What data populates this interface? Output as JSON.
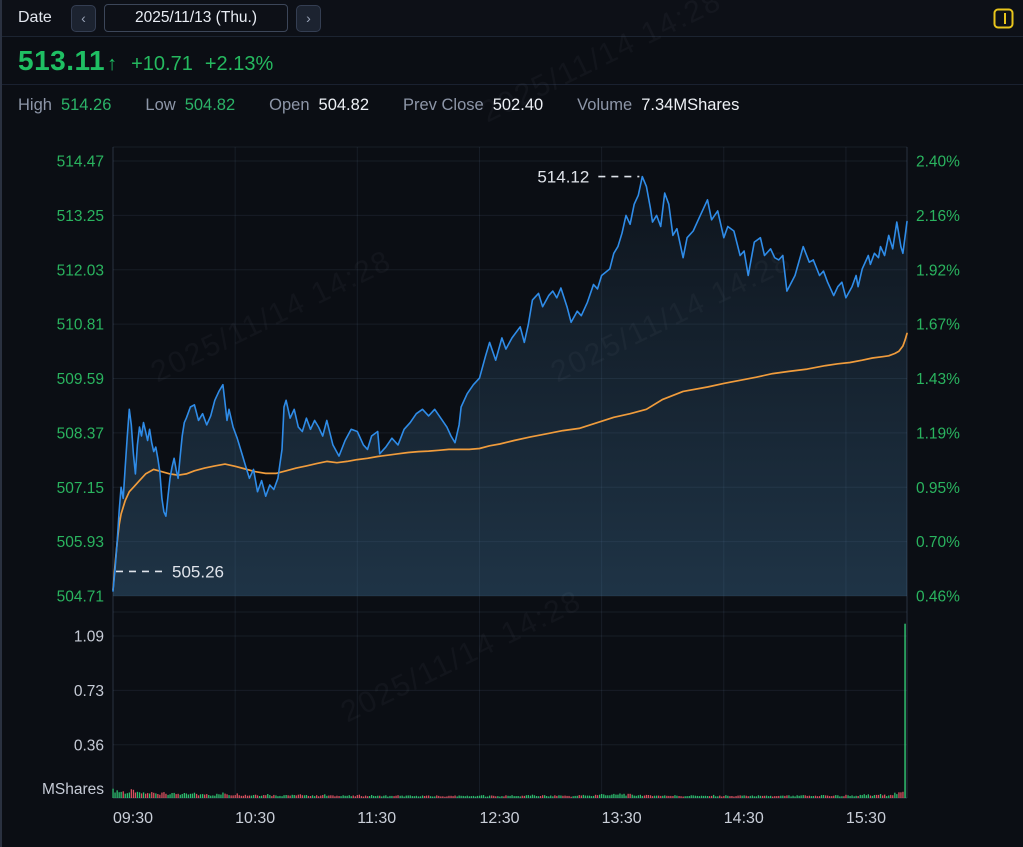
{
  "header": {
    "date_label": "Date",
    "prev_icon": "‹",
    "next_icon": "›",
    "date_value": "2025/11/13 (Thu.)"
  },
  "quote": {
    "price": "513.11",
    "arrow": "↑",
    "change": "+10.71",
    "change_pct": "+2.13%"
  },
  "stats": {
    "high_label": "High",
    "high": "514.26",
    "low_label": "Low",
    "low": "504.82",
    "open_label": "Open",
    "open": "504.82",
    "prev_close_label": "Prev Close",
    "prev_close": "502.40",
    "volume_label": "Volume",
    "volume": "7.34MShares"
  },
  "watermark": {
    "text": "2025/11/14 14:28"
  },
  "chart_data": {
    "type": "line",
    "title": "Intraday price with average price line and volume",
    "price_axis": {
      "left_labels": [
        "514.47",
        "513.25",
        "512.03",
        "510.81",
        "509.59",
        "508.37",
        "507.15",
        "505.93",
        "504.71"
      ],
      "right_labels": [
        "2.40%",
        "2.16%",
        "1.92%",
        "1.67%",
        "1.43%",
        "1.19%",
        "0.95%",
        "0.70%",
        "0.46%"
      ],
      "top": 514.47,
      "bottom": 504.71,
      "prev_close": 502.4
    },
    "time_axis": {
      "labels": [
        "09:30",
        "10:30",
        "11:30",
        "12:30",
        "13:30",
        "14:30",
        "15:30"
      ],
      "tick_minutes": [
        0,
        60,
        120,
        180,
        240,
        300,
        360
      ],
      "session_minutes": 390
    },
    "volume_axis": {
      "labels": [
        "1.09",
        "0.73",
        "0.36"
      ],
      "unit_label": "MShares",
      "grid_value": 0.365
    },
    "annotations": {
      "high": {
        "text": "514.12",
        "minute": 260,
        "price": 514.12
      },
      "low": {
        "text": "505.26",
        "minute": 0,
        "price": 505.26
      }
    },
    "series": {
      "price": [
        [
          0,
          504.82
        ],
        [
          1,
          505.3
        ],
        [
          2,
          505.9
        ],
        [
          3,
          506.6
        ],
        [
          4,
          507.15
        ],
        [
          5,
          506.9
        ],
        [
          6,
          507.6
        ],
        [
          7,
          508.3
        ],
        [
          8,
          508.9
        ],
        [
          9,
          508.55
        ],
        [
          10,
          507.9
        ],
        [
          11,
          507.45
        ],
        [
          12,
          508.1
        ],
        [
          13,
          508.5
        ],
        [
          14,
          508.3
        ],
        [
          15,
          508.6
        ],
        [
          16,
          508.4
        ],
        [
          17,
          508.2
        ],
        [
          18,
          508.45
        ],
        [
          19,
          508.15
        ],
        [
          20,
          507.95
        ],
        [
          21,
          508.05
        ],
        [
          22,
          507.8
        ],
        [
          23,
          507.5
        ],
        [
          24,
          506.9
        ],
        [
          25,
          506.6
        ],
        [
          26,
          506.5
        ],
        [
          27,
          506.95
        ],
        [
          28,
          507.35
        ],
        [
          29,
          507.6
        ],
        [
          30,
          507.8
        ],
        [
          31,
          507.55
        ],
        [
          32,
          507.35
        ],
        [
          33,
          507.85
        ],
        [
          34,
          508.3
        ],
        [
          35,
          508.6
        ],
        [
          36,
          508.7
        ],
        [
          38,
          508.95
        ],
        [
          40,
          509.0
        ],
        [
          42,
          508.65
        ],
        [
          44,
          508.8
        ],
        [
          46,
          508.55
        ],
        [
          48,
          508.75
        ],
        [
          50,
          509.1
        ],
        [
          52,
          509.3
        ],
        [
          54,
          509.45
        ],
        [
          55,
          509.05
        ],
        [
          56,
          508.65
        ],
        [
          57,
          508.9
        ],
        [
          59,
          508.5
        ],
        [
          61,
          508.25
        ],
        [
          63,
          507.95
        ],
        [
          65,
          507.65
        ],
        [
          67,
          507.35
        ],
        [
          69,
          507.55
        ],
        [
          71,
          507.05
        ],
        [
          73,
          507.3
        ],
        [
          75,
          506.95
        ],
        [
          77,
          507.2
        ],
        [
          79,
          507.1
        ],
        [
          81,
          507.35
        ],
        [
          83,
          508.0
        ],
        [
          84,
          508.95
        ],
        [
          85,
          509.1
        ],
        [
          87,
          508.7
        ],
        [
          89,
          508.9
        ],
        [
          91,
          508.5
        ],
        [
          93,
          508.4
        ],
        [
          95,
          508.7
        ],
        [
          97,
          508.45
        ],
        [
          99,
          508.65
        ],
        [
          101,
          508.5
        ],
        [
          103,
          508.3
        ],
        [
          105,
          508.65
        ],
        [
          108,
          508.1
        ],
        [
          111,
          507.85
        ],
        [
          114,
          508.2
        ],
        [
          117,
          508.45
        ],
        [
          120,
          508.4
        ],
        [
          123,
          508.1
        ],
        [
          125,
          508.0
        ],
        [
          127,
          508.3
        ],
        [
          130,
          508.4
        ],
        [
          131,
          507.9
        ],
        [
          134,
          508.05
        ],
        [
          137,
          508.25
        ],
        [
          140,
          508.1
        ],
        [
          143,
          508.45
        ],
        [
          146,
          508.6
        ],
        [
          149,
          508.8
        ],
        [
          152,
          508.9
        ],
        [
          155,
          508.75
        ],
        [
          158,
          508.9
        ],
        [
          161,
          508.7
        ],
        [
          164,
          508.5
        ],
        [
          166,
          508.3
        ],
        [
          168,
          508.15
        ],
        [
          170,
          508.55
        ],
        [
          171,
          508.95
        ],
        [
          174,
          509.25
        ],
        [
          177,
          509.45
        ],
        [
          180,
          509.6
        ],
        [
          183,
          510.1
        ],
        [
          185,
          510.4
        ],
        [
          188,
          510.0
        ],
        [
          191,
          510.5
        ],
        [
          193,
          510.25
        ],
        [
          196,
          510.5
        ],
        [
          200,
          510.75
        ],
        [
          202,
          510.4
        ],
        [
          204,
          510.8
        ],
        [
          206,
          511.35
        ],
        [
          209,
          511.5
        ],
        [
          211,
          511.2
        ],
        [
          214,
          511.45
        ],
        [
          216,
          511.55
        ],
        [
          218,
          511.4
        ],
        [
          220,
          511.62
        ],
        [
          223,
          511.2
        ],
        [
          225,
          510.85
        ],
        [
          228,
          511.1
        ],
        [
          230,
          511.0
        ],
        [
          233,
          511.3
        ],
        [
          236,
          511.7
        ],
        [
          238,
          511.6
        ],
        [
          240,
          511.9
        ],
        [
          244,
          512.05
        ],
        [
          246,
          512.4
        ],
        [
          248,
          512.55
        ],
        [
          250,
          512.85
        ],
        [
          252,
          513.25
        ],
        [
          254,
          513.05
        ],
        [
          256,
          513.5
        ],
        [
          258,
          513.7
        ],
        [
          260,
          514.12
        ],
        [
          262,
          513.9
        ],
        [
          264,
          513.4
        ],
        [
          265,
          513.1
        ],
        [
          267,
          513.25
        ],
        [
          269,
          513.0
        ],
        [
          271,
          513.75
        ],
        [
          273,
          513.5
        ],
        [
          275,
          512.8
        ],
        [
          277,
          512.95
        ],
        [
          280,
          512.3
        ],
        [
          282,
          512.75
        ],
        [
          285,
          512.9
        ],
        [
          288,
          513.2
        ],
        [
          292,
          513.6
        ],
        [
          294,
          513.15
        ],
        [
          297,
          513.35
        ],
        [
          300,
          512.75
        ],
        [
          302,
          513.0
        ],
        [
          305,
          512.9
        ],
        [
          308,
          512.35
        ],
        [
          310,
          512.45
        ],
        [
          312,
          511.9
        ],
        [
          315,
          512.65
        ],
        [
          318,
          512.75
        ],
        [
          320,
          512.35
        ],
        [
          323,
          512.5
        ],
        [
          325,
          512.3
        ],
        [
          327,
          512.25
        ],
        [
          329,
          512.35
        ],
        [
          331,
          511.55
        ],
        [
          335,
          511.9
        ],
        [
          339,
          512.55
        ],
        [
          342,
          512.2
        ],
        [
          344,
          512.25
        ],
        [
          347,
          511.9
        ],
        [
          349,
          512.0
        ],
        [
          351,
          511.75
        ],
        [
          354,
          511.45
        ],
        [
          356,
          511.65
        ],
        [
          358,
          511.75
        ],
        [
          360,
          511.4
        ],
        [
          363,
          511.65
        ],
        [
          365,
          511.9
        ],
        [
          366,
          511.65
        ],
        [
          368,
          512.05
        ],
        [
          371,
          512.35
        ],
        [
          372,
          512.15
        ],
        [
          374,
          512.4
        ],
        [
          376,
          512.3
        ],
        [
          377,
          512.55
        ],
        [
          379,
          512.35
        ],
        [
          381,
          512.8
        ],
        [
          383,
          512.5
        ],
        [
          385,
          513.1
        ],
        [
          387,
          512.55
        ],
        [
          388,
          512.4
        ],
        [
          390,
          513.11
        ]
      ],
      "avg_price": [
        [
          0,
          504.85
        ],
        [
          1,
          505.4
        ],
        [
          2,
          505.9
        ],
        [
          3,
          506.3
        ],
        [
          4,
          506.55
        ],
        [
          6,
          506.85
        ],
        [
          8,
          507.05
        ],
        [
          10,
          507.15
        ],
        [
          13,
          507.3
        ],
        [
          16,
          507.45
        ],
        [
          20,
          507.55
        ],
        [
          24,
          507.5
        ],
        [
          28,
          507.45
        ],
        [
          32,
          507.42
        ],
        [
          36,
          507.45
        ],
        [
          40,
          507.52
        ],
        [
          45,
          507.58
        ],
        [
          50,
          507.63
        ],
        [
          55,
          507.67
        ],
        [
          60,
          507.62
        ],
        [
          65,
          507.56
        ],
        [
          70,
          507.5
        ],
        [
          75,
          507.46
        ],
        [
          80,
          507.46
        ],
        [
          85,
          507.52
        ],
        [
          90,
          507.58
        ],
        [
          95,
          507.63
        ],
        [
          100,
          507.68
        ],
        [
          105,
          507.73
        ],
        [
          110,
          507.7
        ],
        [
          115,
          507.73
        ],
        [
          120,
          507.77
        ],
        [
          125,
          507.8
        ],
        [
          130,
          507.84
        ],
        [
          135,
          507.87
        ],
        [
          140,
          507.9
        ],
        [
          145,
          507.93
        ],
        [
          150,
          507.95
        ],
        [
          155,
          507.96
        ],
        [
          160,
          507.98
        ],
        [
          165,
          508.0
        ],
        [
          170,
          508.0
        ],
        [
          175,
          508.0
        ],
        [
          180,
          508.02
        ],
        [
          185,
          508.08
        ],
        [
          190,
          508.12
        ],
        [
          197,
          508.2
        ],
        [
          205,
          508.28
        ],
        [
          213,
          508.35
        ],
        [
          221,
          508.42
        ],
        [
          229,
          508.47
        ],
        [
          238,
          508.6
        ],
        [
          246,
          508.72
        ],
        [
          254,
          508.8
        ],
        [
          262,
          508.9
        ],
        [
          270,
          509.12
        ],
        [
          280,
          509.3
        ],
        [
          292,
          509.4
        ],
        [
          300,
          509.48
        ],
        [
          308,
          509.55
        ],
        [
          316,
          509.62
        ],
        [
          324,
          509.7
        ],
        [
          332,
          509.75
        ],
        [
          341,
          509.8
        ],
        [
          350,
          509.88
        ],
        [
          356,
          509.92
        ],
        [
          362,
          509.95
        ],
        [
          368,
          510.0
        ],
        [
          373,
          510.05
        ],
        [
          378,
          510.08
        ],
        [
          381,
          510.1
        ],
        [
          384,
          510.15
        ],
        [
          386,
          510.2
        ],
        [
          388,
          510.32
        ],
        [
          389,
          510.45
        ],
        [
          390,
          510.6
        ]
      ],
      "volume_3min_buckets": [
        0.05,
        0.042,
        0.036,
        0.046,
        0.032,
        0.03,
        0.034,
        0.028,
        0.04,
        0.026,
        0.03,
        0.026,
        0.024,
        0.028,
        0.022,
        0.026,
        0.02,
        0.024,
        0.03,
        0.022,
        0.026,
        0.02,
        0.018,
        0.022,
        0.019,
        0.024,
        0.018,
        0.016,
        0.02,
        0.017,
        0.022,
        0.016,
        0.018,
        0.015,
        0.02,
        0.016,
        0.014,
        0.018,
        0.015,
        0.013,
        0.017,
        0.014,
        0.016,
        0.013,
        0.015,
        0.012,
        0.016,
        0.013,
        0.014,
        0.012,
        0.015,
        0.013,
        0.012,
        0.014,
        0.011,
        0.013,
        0.015,
        0.012,
        0.014,
        0.011,
        0.016,
        0.013,
        0.015,
        0.012,
        0.014,
        0.016,
        0.013,
        0.015,
        0.018,
        0.014,
        0.016,
        0.013,
        0.015,
        0.017,
        0.014,
        0.012,
        0.016,
        0.018,
        0.015,
        0.02,
        0.024,
        0.02,
        0.022,
        0.026,
        0.022,
        0.018,
        0.02,
        0.016,
        0.018,
        0.015,
        0.017,
        0.014,
        0.016,
        0.013,
        0.015,
        0.017,
        0.014,
        0.012,
        0.016,
        0.013,
        0.015,
        0.012,
        0.014,
        0.016,
        0.013,
        0.015,
        0.012,
        0.014,
        0.011,
        0.013,
        0.015,
        0.012,
        0.014,
        0.016,
        0.013,
        0.015,
        0.018,
        0.014,
        0.016,
        0.013,
        0.018,
        0.015,
        0.017,
        0.02,
        0.016,
        0.022,
        0.018,
        0.024,
        0.03,
        0.035
      ],
      "close_auction_volume": 1.17
    },
    "colors": {
      "accent_blue": "#2f8ce8",
      "accent_orange": "#f09c3c",
      "axis_green": "#2ab45f",
      "vol_green": "#2dbd6e",
      "vol_red": "#d9505e",
      "spike_green": "#35d97c",
      "vol_label": "#c6cbd6",
      "time_label": "#c9ced8",
      "annotation": "#dfe3ea",
      "fill_top": "rgba(68,124,166,0.06)",
      "fill_bottom": "rgba(68,124,166,0.34)",
      "grid": "rgba(140,165,205,0.10)",
      "grid_strong": "rgba(140,165,205,0.24)",
      "panel_icon_yellow": "#e8c51c"
    },
    "legend": "none",
    "grid": "on"
  }
}
